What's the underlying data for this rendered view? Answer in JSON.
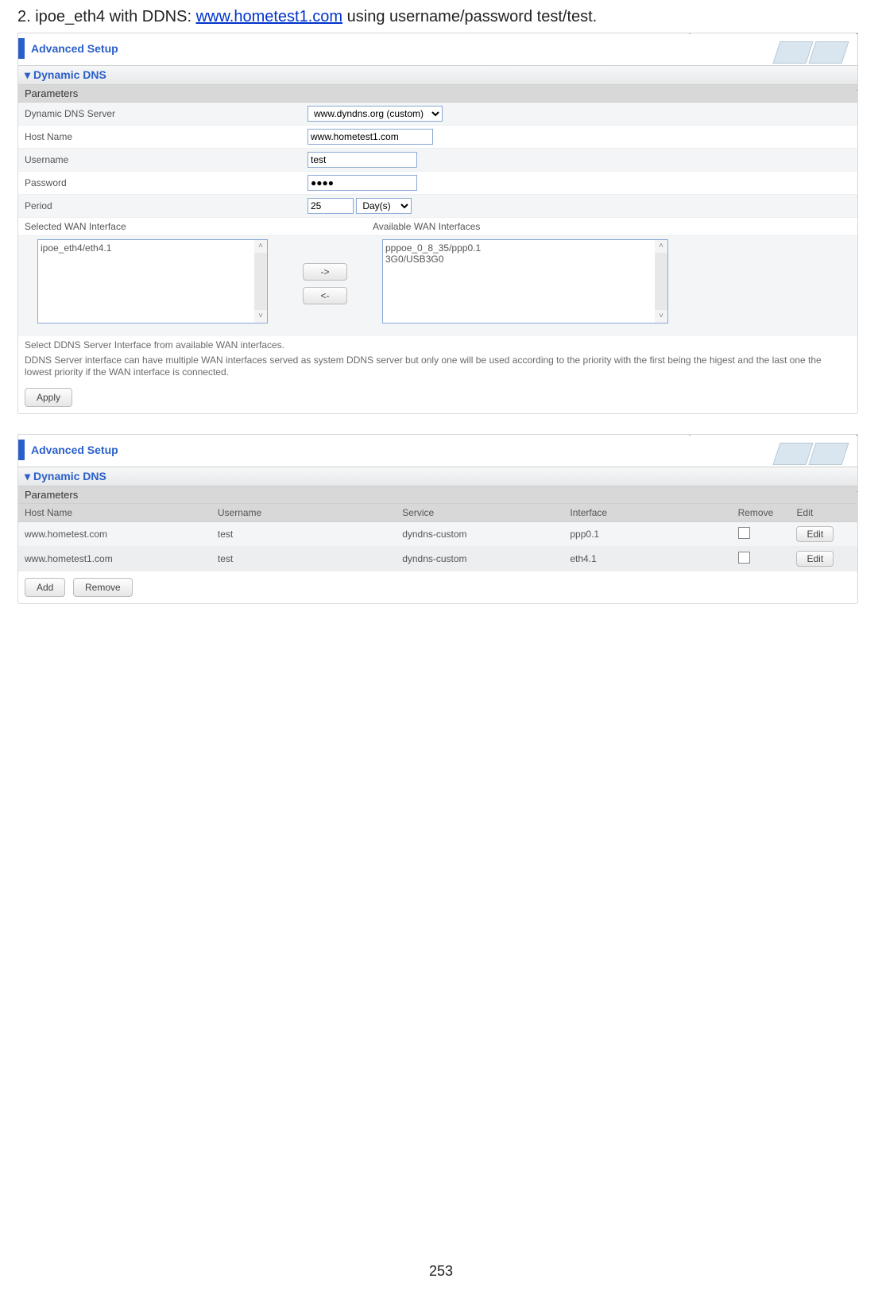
{
  "intro": {
    "prefix": "2. ipoe_eth4 with DDNS: ",
    "link_text": "www.hometest1.com",
    "suffix": " using username/password test/test."
  },
  "panel1": {
    "title": "Advanced Setup",
    "section": "Dynamic DNS",
    "parameters_label": "Parameters",
    "fields": {
      "server_label": "Dynamic DNS Server",
      "server_value": "www.dyndns.org (custom)",
      "host_label": "Host Name",
      "host_value": "www.hometest1.com",
      "user_label": "Username",
      "user_value": "test",
      "pass_label": "Password",
      "pass_value": "●●●●",
      "period_label": "Period",
      "period_value": "25",
      "period_unit": "Day(s)"
    },
    "wan": {
      "selected_label": "Selected WAN Interface",
      "available_label": "Available WAN Interfaces",
      "selected_items": [
        "ipoe_eth4/eth4.1"
      ],
      "available_items": [
        "pppoe_0_8_35/ppp0.1",
        "3G0/USB3G0"
      ],
      "btn_right": "->",
      "btn_left": "<-"
    },
    "help1": "Select DDNS Server Interface from available WAN interfaces.",
    "help2": "DDNS Server interface can have multiple WAN interfaces served as system DDNS server but only one will be used according to the priority with the first being the higest and the last one the lowest priority if the WAN interface is connected.",
    "apply": "Apply"
  },
  "panel2": {
    "title": "Advanced Setup",
    "section": "Dynamic DNS",
    "parameters_label": "Parameters",
    "headers": {
      "host": "Host Name",
      "user": "Username",
      "service": "Service",
      "iface": "Interface",
      "remove": "Remove",
      "edit": "Edit"
    },
    "rows": [
      {
        "host": "www.hometest.com",
        "user": "test",
        "service": "dyndns-custom",
        "iface": "ppp0.1",
        "edit": "Edit"
      },
      {
        "host": "www.hometest1.com",
        "user": "test",
        "service": "dyndns-custom",
        "iface": "eth4.1",
        "edit": "Edit"
      }
    ],
    "add": "Add",
    "remove_btn": "Remove"
  },
  "page_number": "253"
}
